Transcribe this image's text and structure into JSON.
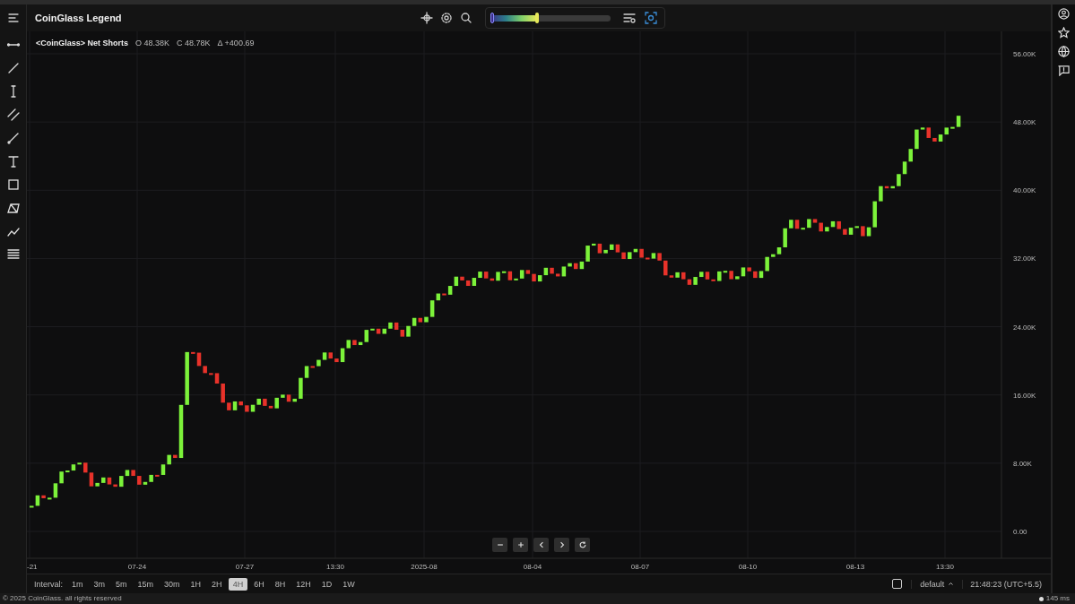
{
  "header": {
    "title": "CoinGlass Legend",
    "color_range": {
      "level": 0.39
    }
  },
  "legend": {
    "name": "<CoinGlass> Net Shorts",
    "items": [
      {
        "label": "O",
        "value": "48.38K"
      },
      {
        "label": "C",
        "value": "48.78K"
      },
      {
        "label": "Δ",
        "value": "+400.69"
      }
    ]
  },
  "y_axis": [
    "56.00K",
    "48.00K",
    "40.00K",
    "32.00K",
    "24.00K",
    "16.00K",
    "8.00K",
    "0.00"
  ],
  "x_axis": [
    "-21",
    "07-24",
    "07-27",
    "13:30",
    "2025-08",
    "08-04",
    "08-07",
    "08-10",
    "08-13",
    "13:30"
  ],
  "interval_label": "Interval:",
  "intervals": [
    {
      "label": "1m",
      "selected": false
    },
    {
      "label": "3m",
      "selected": false
    },
    {
      "label": "5m",
      "selected": false
    },
    {
      "label": "15m",
      "selected": false
    },
    {
      "label": "30m",
      "selected": false
    },
    {
      "label": "1H",
      "selected": false
    },
    {
      "label": "2H",
      "selected": false
    },
    {
      "label": "4H",
      "selected": true
    },
    {
      "label": "6H",
      "selected": false
    },
    {
      "label": "8H",
      "selected": false
    },
    {
      "label": "12H",
      "selected": false
    },
    {
      "label": "1D",
      "selected": false
    },
    {
      "label": "1W",
      "selected": false
    }
  ],
  "view_toggle": {
    "checked": false
  },
  "theme": "default",
  "clock": "21:48:23 (UTC+5.5)",
  "footer": {
    "copyright": "© 2025 CoinGlass. all rights reserved",
    "latency": "145 ms"
  }
}
